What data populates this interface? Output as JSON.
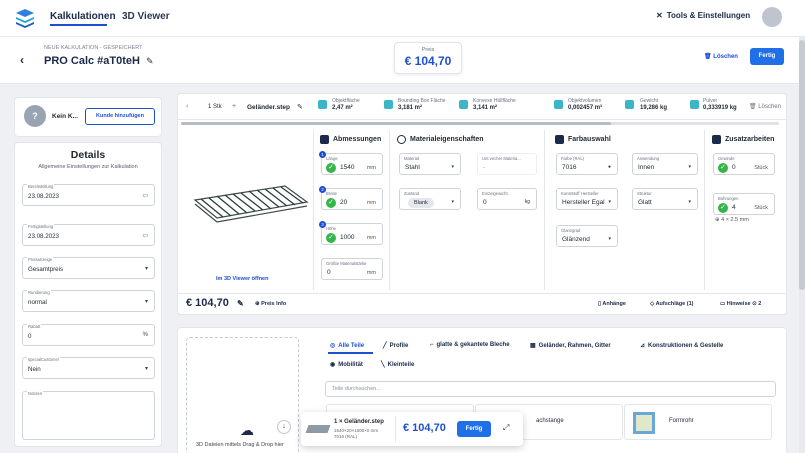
{
  "nav": {
    "tab_kalkulationen": "Kalkulationen",
    "tab_3d": "3D Viewer",
    "tools": "Tools & Einstellungen"
  },
  "header": {
    "subtitle": "NEUE KALKULATION - GESPEICHERT",
    "title": "PRO Calc #aT0teH",
    "price_label": "Preis",
    "price_value": "€ 104,70",
    "delete": "Löschen",
    "done": "Fertig"
  },
  "customer": {
    "none": "Kein K...",
    "add": "Kunde hinzufügen"
  },
  "details": {
    "title": "Details",
    "desc": "Allgemeine Einstellungen zur Kalkulation",
    "fields": [
      {
        "label": "Bereitstellung",
        "value": "23.08.2023",
        "icon": "calendar-icon"
      },
      {
        "label": "Fertigstellung",
        "value": "23.08.2023",
        "icon": "calendar-icon"
      },
      {
        "label": "Preisanzeige",
        "value": "Gesamtpreis",
        "icon": "chevron-down-icon"
      },
      {
        "label": "Rundierung",
        "value": "normal",
        "icon": "chevron-down-icon"
      },
      {
        "label": "Rabatt",
        "value": "0",
        "icon": "%"
      },
      {
        "label": "specialCustomer",
        "value": "Nein",
        "icon": "chevron-down-icon"
      },
      {
        "label": "Notizen",
        "value": "",
        "icon": ""
      }
    ]
  },
  "toolbar": {
    "qty": "1 Stk",
    "file": "Geländer.step",
    "delete": "Löschen",
    "stats": [
      {
        "label": "Objektfläche",
        "value": "2,47 m²"
      },
      {
        "label": "Bounding Box Fläche",
        "value": "3,181 m²"
      },
      {
        "label": "Konvexe Hüllfläche",
        "value": "3,141 m²"
      },
      {
        "label": "Objektvolumen",
        "value": "0,002457 m³"
      },
      {
        "label": "Gewicht",
        "value": "19,286 kg"
      },
      {
        "label": "Pulver",
        "value": "0,333919 kg"
      }
    ]
  },
  "preview": {
    "open_viewer": "Im 3D Viewer öffnen"
  },
  "dims": {
    "title": "Abmessungen",
    "fields": [
      {
        "label": "Länge",
        "value": "1540",
        "unit": "mm"
      },
      {
        "label": "Breite",
        "value": "20",
        "unit": "mm"
      },
      {
        "label": "Höhe",
        "value": "1000",
        "unit": "mm"
      },
      {
        "label": "Größte Materialstärke",
        "value": "0",
        "unit": "mm"
      }
    ]
  },
  "material": {
    "title": "Materialeigenschaften",
    "material_label": "Material",
    "material_value": "Stahl",
    "sub_label": "Unt vecher Materia...",
    "sub_value": "-",
    "state_label": "Zustand",
    "state_value": "Blank",
    "weight_label": "Einzelgewicht",
    "weight_value": "0",
    "weight_unit": "kg"
  },
  "color": {
    "title": "Farbauswahl",
    "ral_label": "Farbe (RAL)",
    "ral_value": "7016",
    "app_label": "Anwendung",
    "app_value": "Innen",
    "maker_label": "Kunststoff Hersteller",
    "maker_value": "Hersteller Egal",
    "struct_label": "Struktur",
    "struct_value": "Glatt",
    "gloss_label": "Glanzgrad",
    "gloss_value": "Glänzend"
  },
  "extra": {
    "title": "Zusatzarbeiten",
    "thread_label": "Gewinde",
    "thread_value": "0",
    "thread_unit": "Stück",
    "drill_label": "Bohrungen",
    "drill_value": "4",
    "drill_unit": "Stück",
    "note": "4 × 2.5 mm"
  },
  "footer": {
    "price": "€ 104,70",
    "price_info": "Preis Info",
    "attach": "Anhänge",
    "surcharge": "Aufschläge (1)",
    "hints": "Hinweise",
    "hints_count": "2"
  },
  "library": {
    "drop": "3D Dateien mittels Drag & Drop hier",
    "cats": [
      "Alle Teile",
      "Profile",
      "glatte & gekantete Bleche",
      "Geländer, Rahmen, Gitter",
      "Konstruktionen & Gestelle",
      "Mobilität",
      "Kleinteile"
    ],
    "search_placeholder": "Teile durchsuchen...",
    "tile_2": "achstange",
    "tile_3": "Formrohr"
  },
  "popup": {
    "title": "1 × Geländer.step",
    "dims": "1540×20×1000×0 mm",
    "ral": "7016 (RAL)",
    "price": "€ 104,70",
    "done": "Fertig"
  },
  "colors": {
    "accent": "#1f4fd1",
    "button": "#1f6fe6",
    "check": "#35b54a",
    "teal": "#3bb5c7"
  }
}
